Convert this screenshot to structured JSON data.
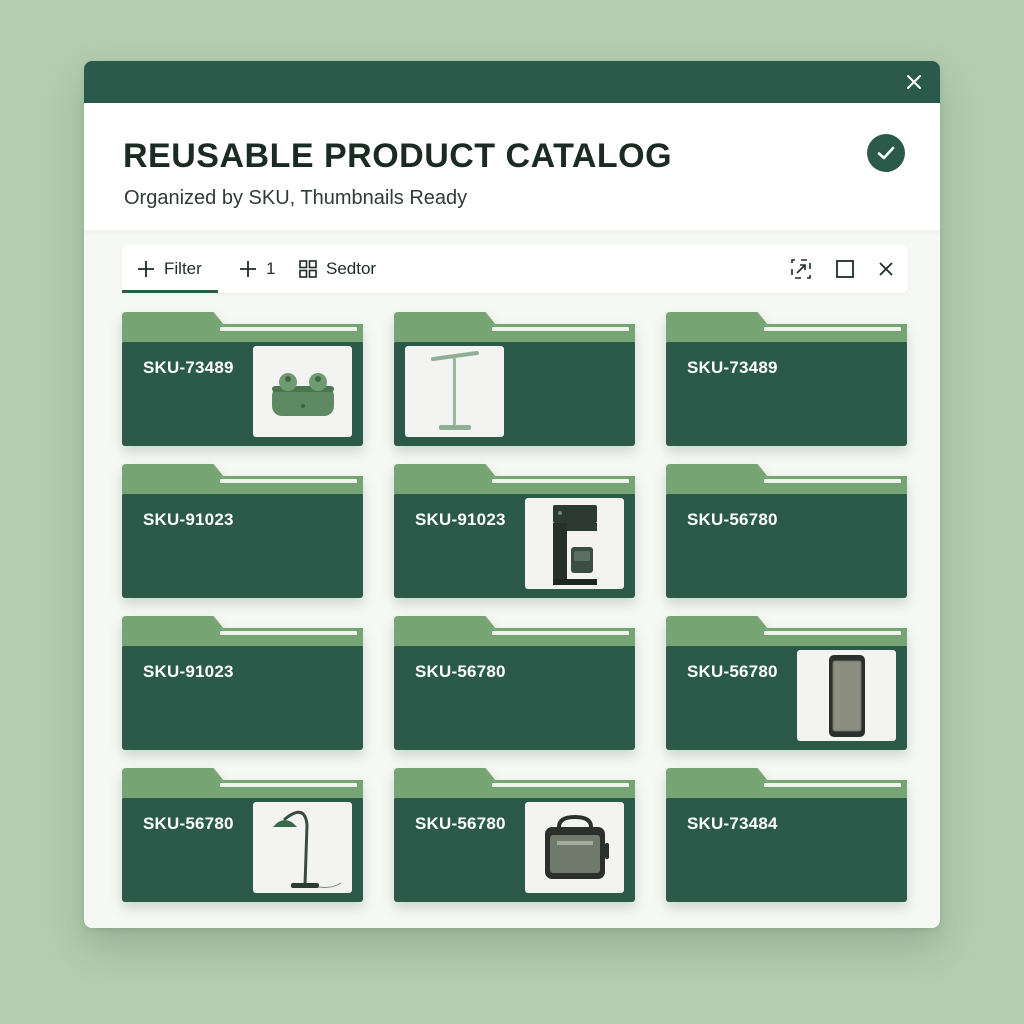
{
  "window": {
    "title": "REUSABLE PRODUCT CATALOG",
    "subtitle": "Organized by SKU, Thumbnails Ready"
  },
  "toolbar": {
    "filter_label": "Filter",
    "count_label": "1",
    "sector_label": "Sedtor"
  },
  "icons": {
    "close": "close-icon",
    "status": "check-circle-icon",
    "add": "plus-icon",
    "grid": "grid-icon",
    "expand": "expand-icon",
    "maximize": "maximize-icon"
  },
  "colors": {
    "accent": "#2c5a4a",
    "folder_tab": "#77a473",
    "background": "#b4cdb0"
  },
  "folders": [
    {
      "sku": "SKU-73489",
      "thumbnail": "earbuds"
    },
    {
      "sku": "",
      "thumbnail": "floor-lamp"
    },
    {
      "sku": "SKU-73489",
      "thumbnail": ""
    },
    {
      "sku": "SKU-91023",
      "thumbnail": ""
    },
    {
      "sku": "SKU-91023",
      "thumbnail": "coffee-maker"
    },
    {
      "sku": "SKU-56780",
      "thumbnail": ""
    },
    {
      "sku": "SKU-91023",
      "thumbnail": ""
    },
    {
      "sku": "SKU-56780",
      "thumbnail": ""
    },
    {
      "sku": "SKU-56780",
      "thumbnail": "air-purifier"
    },
    {
      "sku": "SKU-56780",
      "thumbnail": "desk-lamp"
    },
    {
      "sku": "SKU-56780",
      "thumbnail": "speaker"
    },
    {
      "sku": "SKU-73484",
      "thumbnail": ""
    }
  ]
}
